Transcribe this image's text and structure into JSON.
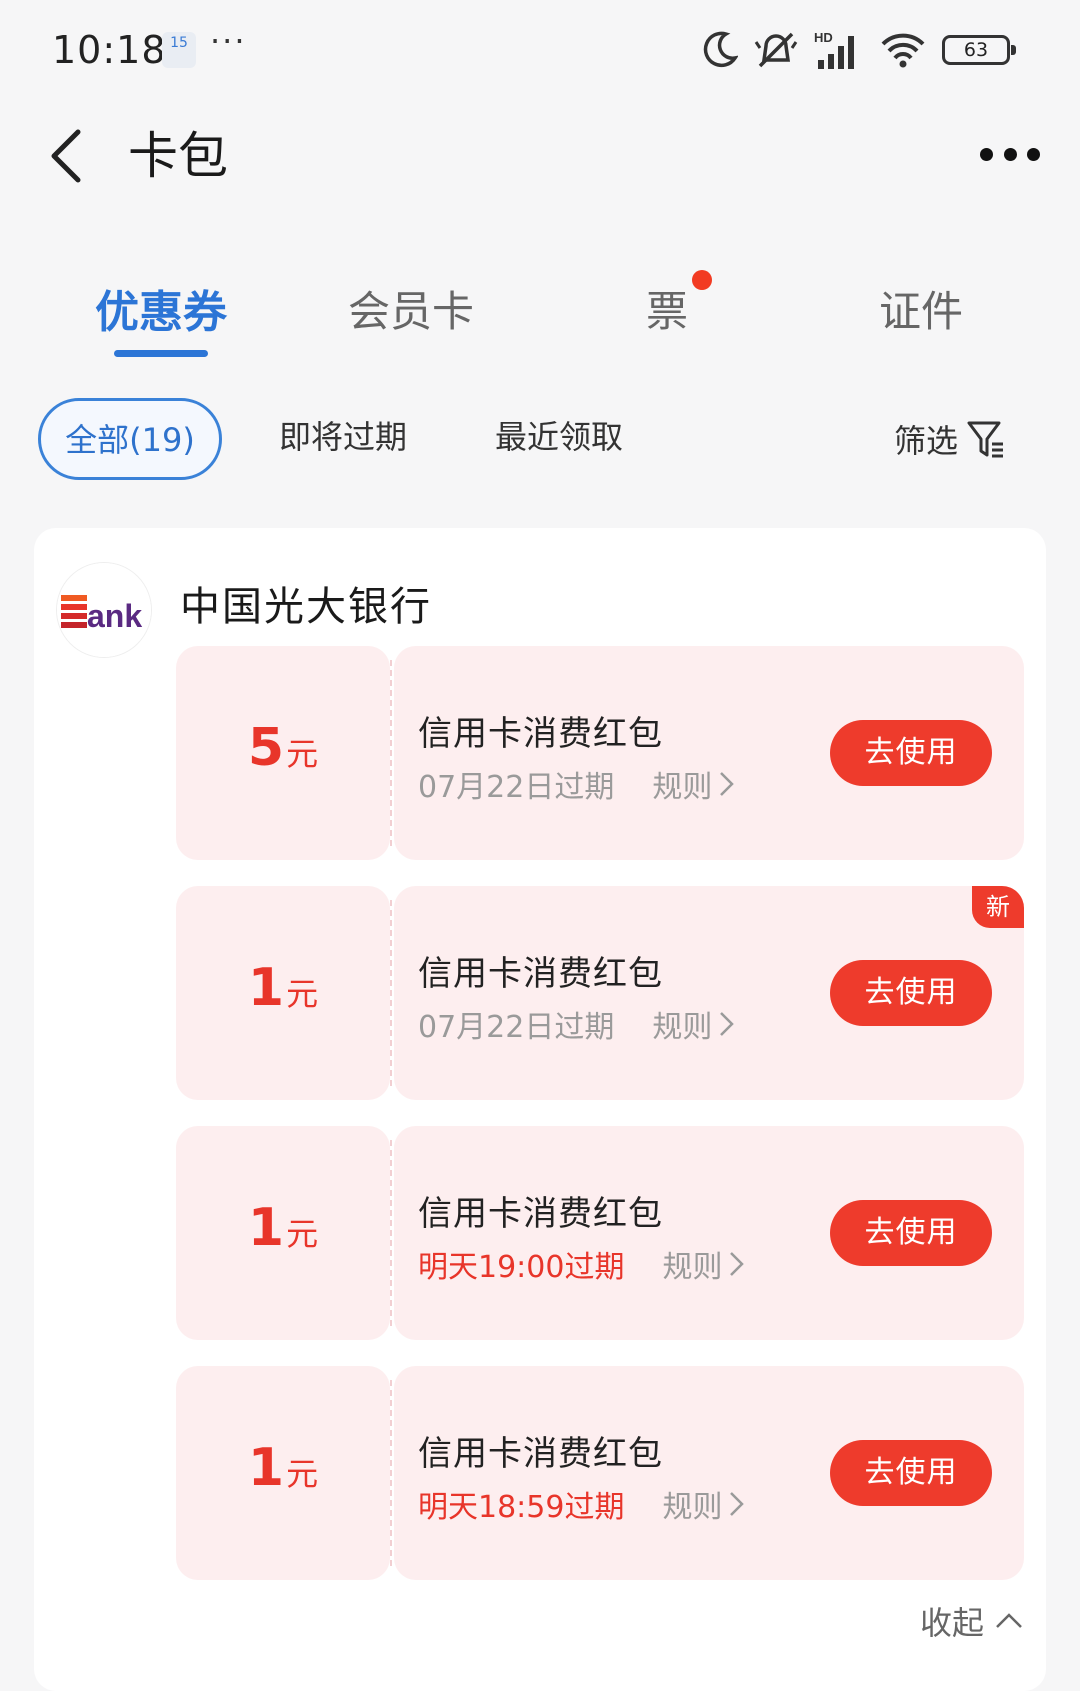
{
  "status_bar": {
    "time": "10:18",
    "note_badge": "15",
    "dots": "···",
    "battery": "63",
    "network_label": "HD"
  },
  "header": {
    "title": "卡包"
  },
  "tabs": [
    {
      "label": "优惠券",
      "active": true
    },
    {
      "label": "会员卡",
      "active": false
    },
    {
      "label": "票",
      "active": false,
      "has_dot": true
    },
    {
      "label": "证件",
      "active": false
    }
  ],
  "filters": {
    "chips": [
      {
        "label": "全部(19)",
        "active": true
      },
      {
        "label": "即将过期",
        "active": false
      },
      {
        "label": "最近领取",
        "active": false
      }
    ],
    "filter_label": "筛选"
  },
  "group": {
    "bank_name": "中国光大银行",
    "logo_text": "Bank",
    "coupons": [
      {
        "amount": "5",
        "unit": "元",
        "title": "信用卡消费红包",
        "expire": "07月22日过期",
        "expire_urgent": false,
        "rule": "规则",
        "button": "去使用",
        "is_new": false
      },
      {
        "amount": "1",
        "unit": "元",
        "title": "信用卡消费红包",
        "expire": "07月22日过期",
        "expire_urgent": false,
        "rule": "规则",
        "button": "去使用",
        "is_new": true,
        "new_label": "新"
      },
      {
        "amount": "1",
        "unit": "元",
        "title": "信用卡消费红包",
        "expire": "明天19:00过期",
        "expire_urgent": true,
        "rule": "规则",
        "button": "去使用",
        "is_new": false
      },
      {
        "amount": "1",
        "unit": "元",
        "title": "信用卡消费红包",
        "expire": "明天18:59过期",
        "expire_urgent": true,
        "rule": "规则",
        "button": "去使用",
        "is_new": false
      }
    ],
    "collapse_label": "收起"
  },
  "colors": {
    "accent_blue": "#2c75d6",
    "coupon_red": "#e8352a",
    "coupon_bg": "#fdeeef",
    "button_red": "#ee3b2c"
  }
}
